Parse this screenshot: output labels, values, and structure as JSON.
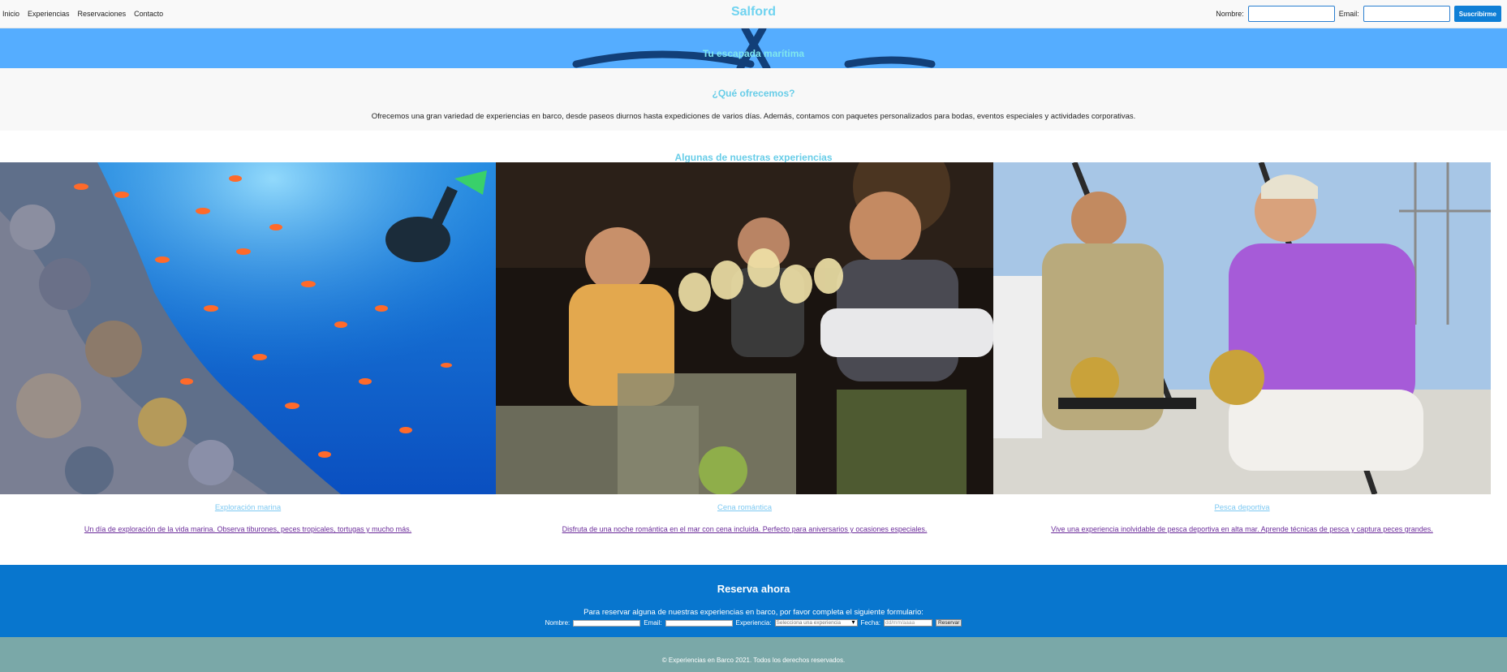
{
  "header": {
    "nav": [
      "Inicio",
      "Experiencias",
      "Reservaciones",
      "Contacto"
    ],
    "brand": "Salford",
    "subscribe": {
      "name_label": "Nombre:",
      "email_label": "Email:",
      "button": "Suscribirme"
    }
  },
  "hero": {
    "tagline": "Tu escapada marítima"
  },
  "offer": {
    "title": "¿Qué ofrecemos?",
    "text": "Ofrecemos una gran variedad de experiencias en barco, desde paseos diurnos hasta expediciones de varios días. Además, contamos con paquetes personalizados para bodas, eventos especiales y actividades corporativas."
  },
  "experiences": {
    "title": "Algunas de nuestras experiencias",
    "cards": [
      {
        "title": "Exploración marina",
        "description": "Un día de exploración de la vida marina. Observa tiburones, peces tropicales, tortugas y mucho más."
      },
      {
        "title": "Cena romántica",
        "description": "Disfruta de una noche romántica en el mar con cena incluida. Perfecto para aniversarios y ocasiones especiales."
      },
      {
        "title": "Pesca deportiva",
        "description": "Vive una experiencia inolvidable de pesca deportiva en alta mar. Aprende técnicas de pesca y captura peces grandes."
      }
    ]
  },
  "reserve": {
    "title": "Reserva ahora",
    "text": "Para reservar alguna de nuestras experiencias en barco, por favor completa el siguiente formulario:",
    "name_label": "Nombre:",
    "email_label": "Email:",
    "experience_label": "Experiencia:",
    "experience_placeholder": "Selecciona una experiencia",
    "date_label": "Fecha:",
    "date_placeholder": "dd/mm/aaaa",
    "button": "Reservar"
  },
  "footer": {
    "text": "© Experiencias en Barco 2021. Todos los derechos reservados."
  },
  "colors": {
    "accent": "#0876ce",
    "hero": "#55adff",
    "title": "#68cde8",
    "footer": "#7aa8a8"
  }
}
